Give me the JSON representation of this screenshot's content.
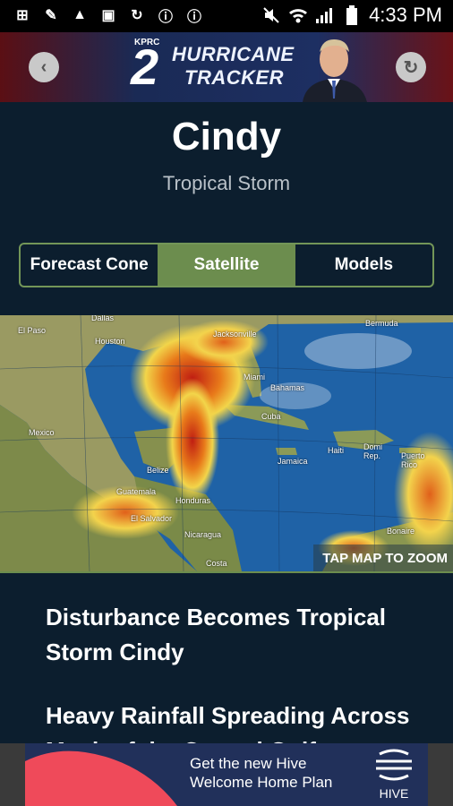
{
  "status_bar": {
    "time": "4:33 PM",
    "left_icons": [
      "add-box-icon",
      "pen-icon",
      "warning-icon",
      "image-icon",
      "sync-icon",
      "alert-icon",
      "alert-icon"
    ],
    "right_icons": [
      "mute-icon",
      "wifi-icon",
      "signal-icon",
      "battery-icon"
    ]
  },
  "header": {
    "logo_kprc": "KPRC",
    "logo_number": "2",
    "logo_line1": "HURRICANE",
    "logo_line2": "TRACKER"
  },
  "storm": {
    "name": "Cindy",
    "type": "Tropical Storm"
  },
  "tabs": [
    {
      "label": "Forecast Cone",
      "active": false
    },
    {
      "label": "Satellite",
      "active": true
    },
    {
      "label": "Models",
      "active": false
    }
  ],
  "map": {
    "zoom_label": "TAP MAP TO ZOOM",
    "places": [
      "Dallas",
      "El Paso",
      "Houston",
      "Jacksonville",
      "Bermuda",
      "Miami",
      "Bahamas",
      "Mexico",
      "Cuba",
      "Haiti",
      "Domi Rep.",
      "Puerto Rico",
      "Belize",
      "Jamaica",
      "Guatemala",
      "Honduras",
      "El Salvador",
      "Nicaragua",
      "Bonaire",
      "Costa"
    ]
  },
  "news": [
    "Disturbance Becomes Tropical Storm Cindy",
    "Heavy Rainfall Spreading Across Much of the Central Gulf"
  ],
  "ad": {
    "line1": "Get the new Hive",
    "line2": "Welcome Home Plan",
    "brand": "HIVE"
  },
  "colors": {
    "background": "#0c1e2e",
    "accent_green": "#6c8d4e",
    "header_blue": "#1d2f62"
  }
}
